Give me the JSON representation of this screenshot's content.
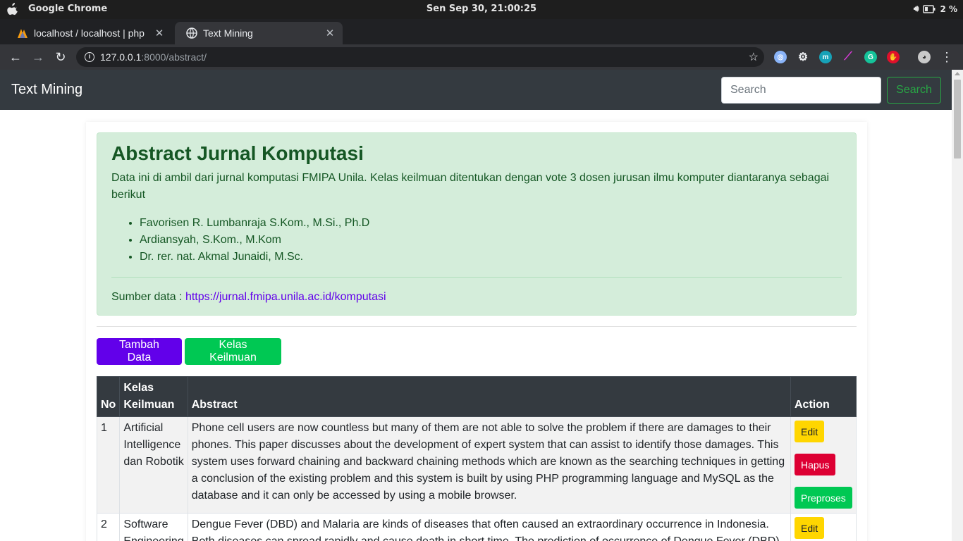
{
  "os": {
    "app_name": "Google Chrome",
    "clock": "Sen Sep 30, 21:00:25",
    "battery": "2 %"
  },
  "browser": {
    "tabs": [
      {
        "label": "localhost / localhost | php"
      },
      {
        "label": "Text Mining"
      }
    ],
    "url_host": "127.0.0.1",
    "url_path": ":8000/abstract/",
    "new_tab": "+"
  },
  "navbar": {
    "brand": "Text Mining",
    "search_placeholder": "Search",
    "search_button": "Search"
  },
  "alert": {
    "title": "Abstract Jurnal Komputasi",
    "description": "Data ini di ambil dari jurnal komputasi FMIPA Unila. Kelas keilmuan ditentukan dengan vote 3 dosen jurusan ilmu komputer diantaranya sebagai berikut",
    "lecturers": [
      "Favorisen R. Lumbanraja S.Kom., M.Si., Ph.D",
      "Ardiansyah, S.Kom., M.Kom",
      "Dr. rer. nat. Akmal Junaidi, M.Sc."
    ],
    "source_label": "Sumber data : ",
    "source_link": "https://jurnal.fmipa.unila.ac.id/komputasi"
  },
  "buttons": {
    "add": "Tambah Data",
    "kelas": "Kelas Keilmuan"
  },
  "table": {
    "headers": {
      "no": "No",
      "kelas": "Kelas Keilmuan",
      "abstract": "Abstract",
      "action": "Action"
    },
    "rows": [
      {
        "no": "1",
        "kelas": "Artificial Intelligence dan Robotik",
        "abstract": "Phone cell users are now countless but many of them are not able to solve the problem if there are damages to their phones. This paper discusses about the development of expert system that can assist to identify those damages. This system uses forward chaining and backward chaining methods which are known as the searching techniques in getting a conclusion of the existing problem and this system is built by using PHP programming language and MySQL as the database and it can only be accessed by using a mobile browser."
      },
      {
        "no": "2",
        "kelas": "Software Engineering",
        "abstract": "Dengue Fever (DBD) and Malaria are kinds of diseases that often caused an extraordinary occurrence in Indonesia. Both diseases can spread rapidly and cause death in short time. The prediction of occurrence of Dengue Fever (DBD)"
      }
    ],
    "actions": {
      "edit": "Edit",
      "delete": "Hapus",
      "preprocess": "Preproses"
    }
  },
  "colors": {
    "navbar": "#343a40",
    "alert_bg": "#d4edda",
    "alert_text": "#155724",
    "primary": "#6200ea",
    "success": "#00c853",
    "edit": "#ffd600",
    "delete": "#dd0033"
  }
}
